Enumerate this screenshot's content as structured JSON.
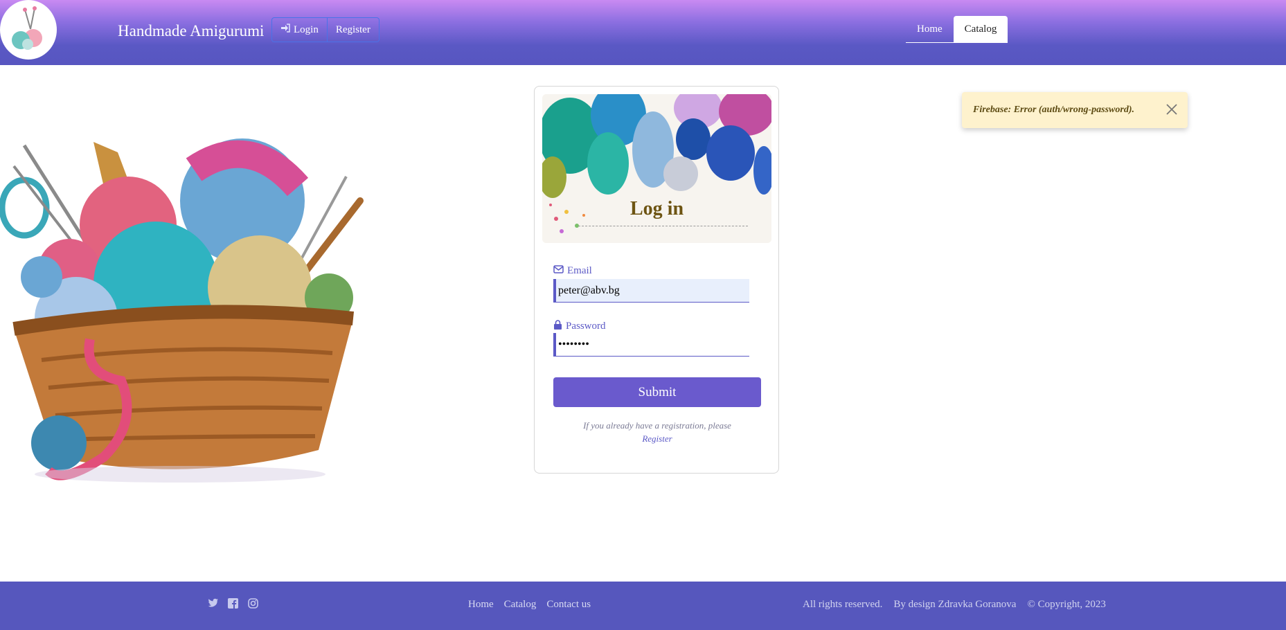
{
  "header": {
    "brand": "Handmade Amigurumi",
    "auth": {
      "login": "Login",
      "register": "Register"
    },
    "nav": [
      {
        "label": "Home",
        "active": false
      },
      {
        "label": "Catalog",
        "active": true
      }
    ]
  },
  "login_card": {
    "title": "Log in",
    "email_label": "Email",
    "email_value": "peter@abv.bg",
    "password_label": "Password",
    "password_value": "••••••••",
    "submit": "Submit",
    "note": "If you already have a registration, please",
    "note_link": "Register"
  },
  "toast": {
    "message": "Firebase: Error (auth/wrong-password)."
  },
  "footer": {
    "social": [
      "twitter-icon",
      "facebook-icon",
      "instagram-icon"
    ],
    "links": [
      "Home",
      "Catalog",
      "Contact us"
    ],
    "rights": "All rights reserved.",
    "design": "By design Zdravka Goranova",
    "copyright": "© Copyright, 2023"
  },
  "colors": {
    "primary": "#5b59c6",
    "button": "#6a5acd",
    "toast_bg": "#fef2cd",
    "footer_bg": "#5657bd",
    "title": "#6d5412"
  }
}
